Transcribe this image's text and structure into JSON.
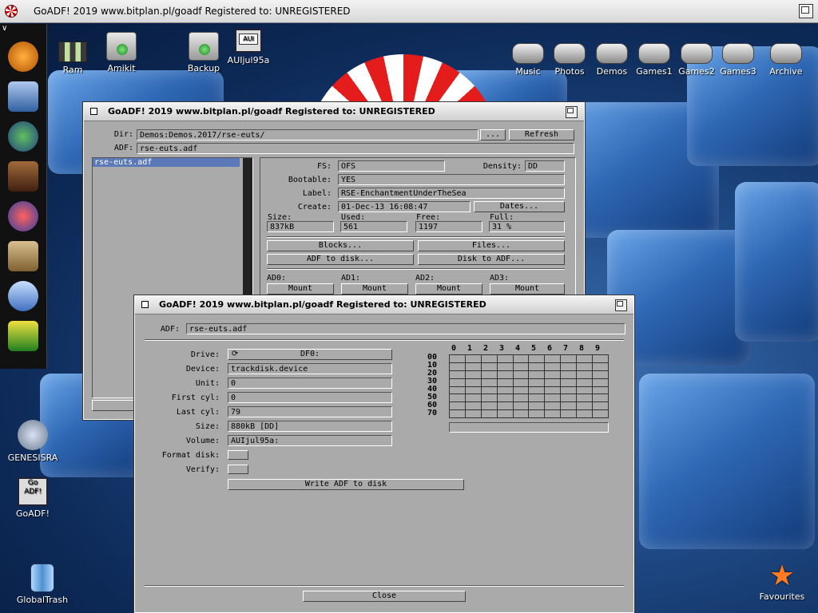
{
  "screen": {
    "title": "GoADF! 2019 www.bitplan.pl/goadf  Registered to: UNREGISTERED"
  },
  "dock": {
    "header": "∨",
    "icons": [
      "genesis-icon",
      "settings-icon",
      "browser-icon",
      "chewbacca-icon",
      "tool-icon",
      "face-icon",
      "search-icon",
      "lightning-icon"
    ]
  },
  "desktop_icons": {
    "ram": "Ram",
    "amikit": "Amikit",
    "backup": "Backup",
    "auijul": "AUIjul95a",
    "auijul_label_img": "AUI",
    "music": "Music",
    "photos": "Photos",
    "demos": "Demos",
    "games1": "Games1",
    "games2": "Games2",
    "games3": "Games3",
    "archive": "Archive",
    "genesisra": "GENESISRA",
    "goadf": "GoADF!",
    "goadf_img": "Go ADF!",
    "globaltrash": "GlobalTrash",
    "favourites": "Favourites"
  },
  "win1": {
    "title": "GoADF! 2019 www.bitplan.pl/goadf  Registered to: UNREGISTERED",
    "dir_label": "Dir:",
    "dir_value": "Demos:Demos.2017/rse-euts/",
    "browse": "...",
    "refresh": "Refresh",
    "adf_label": "ADF:",
    "adf_value": "rse-euts.adf",
    "list_items": [
      "rse-euts.adf"
    ],
    "fs_label": "FS:",
    "fs_value": "OFS",
    "density_label": "Density:",
    "density_value": "DD",
    "bootable_label": "Bootable:",
    "bootable_value": "YES",
    "label_label": "Label:",
    "label_value": "RSE-EnchantmentUnderTheSea",
    "create_label": "Create:",
    "create_value": "01-Dec-13 16:08:47",
    "dates_btn": "Dates...",
    "size_label": "Size:",
    "size_value": "837kB",
    "used_label": "Used:",
    "used_value": "561",
    "free_label": "Free:",
    "free_value": "1197",
    "full_label": "Full:",
    "full_value": "31 %",
    "blocks_btn": "Blocks...",
    "files_btn": "Files...",
    "adf_to_disk_btn": "ADF to disk...",
    "disk_to_adf_btn": "Disk to ADF...",
    "ad0": "AD0:",
    "ad1": "AD1:",
    "ad2": "AD2:",
    "ad3": "AD3:",
    "mount": "Mount"
  },
  "win2": {
    "title": "GoADF! 2019 www.bitplan.pl/goadf  Registered to: UNREGISTERED",
    "adf_label": "ADF:",
    "adf_value": "rse-euts.adf",
    "drive_label": "Drive:",
    "drive_value": "DF0:",
    "device_label": "Device:",
    "device_value": "trackdisk.device",
    "unit_label": "Unit:",
    "unit_value": "0",
    "firstcyl_label": "First cyl:",
    "firstcyl_value": "0",
    "lastcyl_label": "Last cyl:",
    "lastcyl_value": "79",
    "size_label": "Size:",
    "size_value": "880kB    [DD]",
    "volume_label": "Volume:",
    "volume_value": "AUIjul95a:",
    "format_label": "Format disk:",
    "verify_label": "Verify:",
    "write_btn": "Write ADF to disk",
    "close_btn": "Close",
    "grid_cols": [
      "0",
      "1",
      "2",
      "3",
      "4",
      "5",
      "6",
      "7",
      "8",
      "9"
    ],
    "grid_rows": [
      "00",
      "10",
      "20",
      "30",
      "40",
      "50",
      "60",
      "70"
    ]
  }
}
